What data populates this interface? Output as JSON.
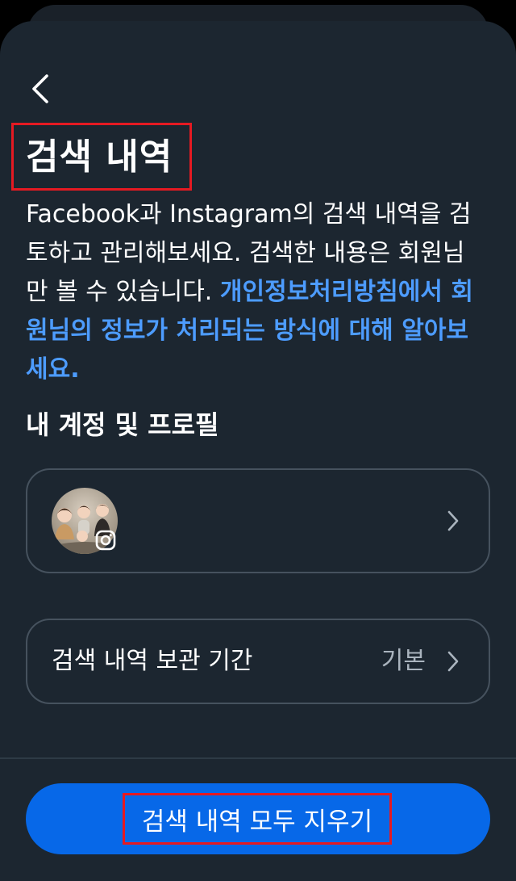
{
  "header": {
    "back_icon": "chevron-left-icon",
    "title": "검색 내역"
  },
  "description": {
    "text": "Facebook과 Instagram의 검색 내역을 검토하고 관리해보세요. 검색한 내용은 회원님만 볼 수 있습니다. ",
    "link_text": "개인정보처리방침에서 회원님의 정보가 처리되는 방식에 대해 알아보세요."
  },
  "accounts_section": {
    "heading": "내 계정 및 프로필",
    "profile": {
      "avatar_icon": "profile-avatar",
      "badge_icon": "instagram-icon",
      "chevron_icon": "chevron-right-icon"
    }
  },
  "retention": {
    "label": "검색 내역 보관 기간",
    "value": "기본",
    "chevron_icon": "chevron-right-icon"
  },
  "actions": {
    "clear_all_label": "검색 내역 모두 지우기"
  },
  "colors": {
    "background": "#1c2630",
    "link": "#4d9cff",
    "primary_button": "#0768e8",
    "highlight_box": "#e51a22"
  }
}
